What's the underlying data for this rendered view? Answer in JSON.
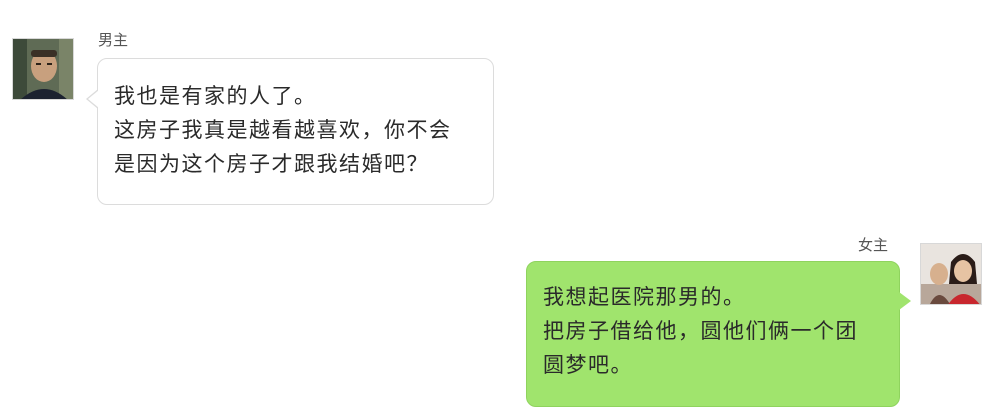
{
  "colors": {
    "incoming_bubble": "#ffffff",
    "outgoing_bubble": "#a0e46d",
    "text": "#2a2a2a",
    "name_text": "#555555"
  },
  "messages": [
    {
      "sender": "男主",
      "side": "left",
      "avatar_icon": "male-avatar-photo",
      "lines": [
        "我也是有家的人了。",
        "这房子我真是越看越喜欢，你不会",
        "是因为这个房子才跟我结婚吧？"
      ]
    },
    {
      "sender": "女主",
      "side": "right",
      "avatar_icon": "female-avatar-photo",
      "lines": [
        "我想起医院那男的。",
        "把房子借给他，圆他们俩一个团",
        "圆梦吧。"
      ]
    }
  ]
}
